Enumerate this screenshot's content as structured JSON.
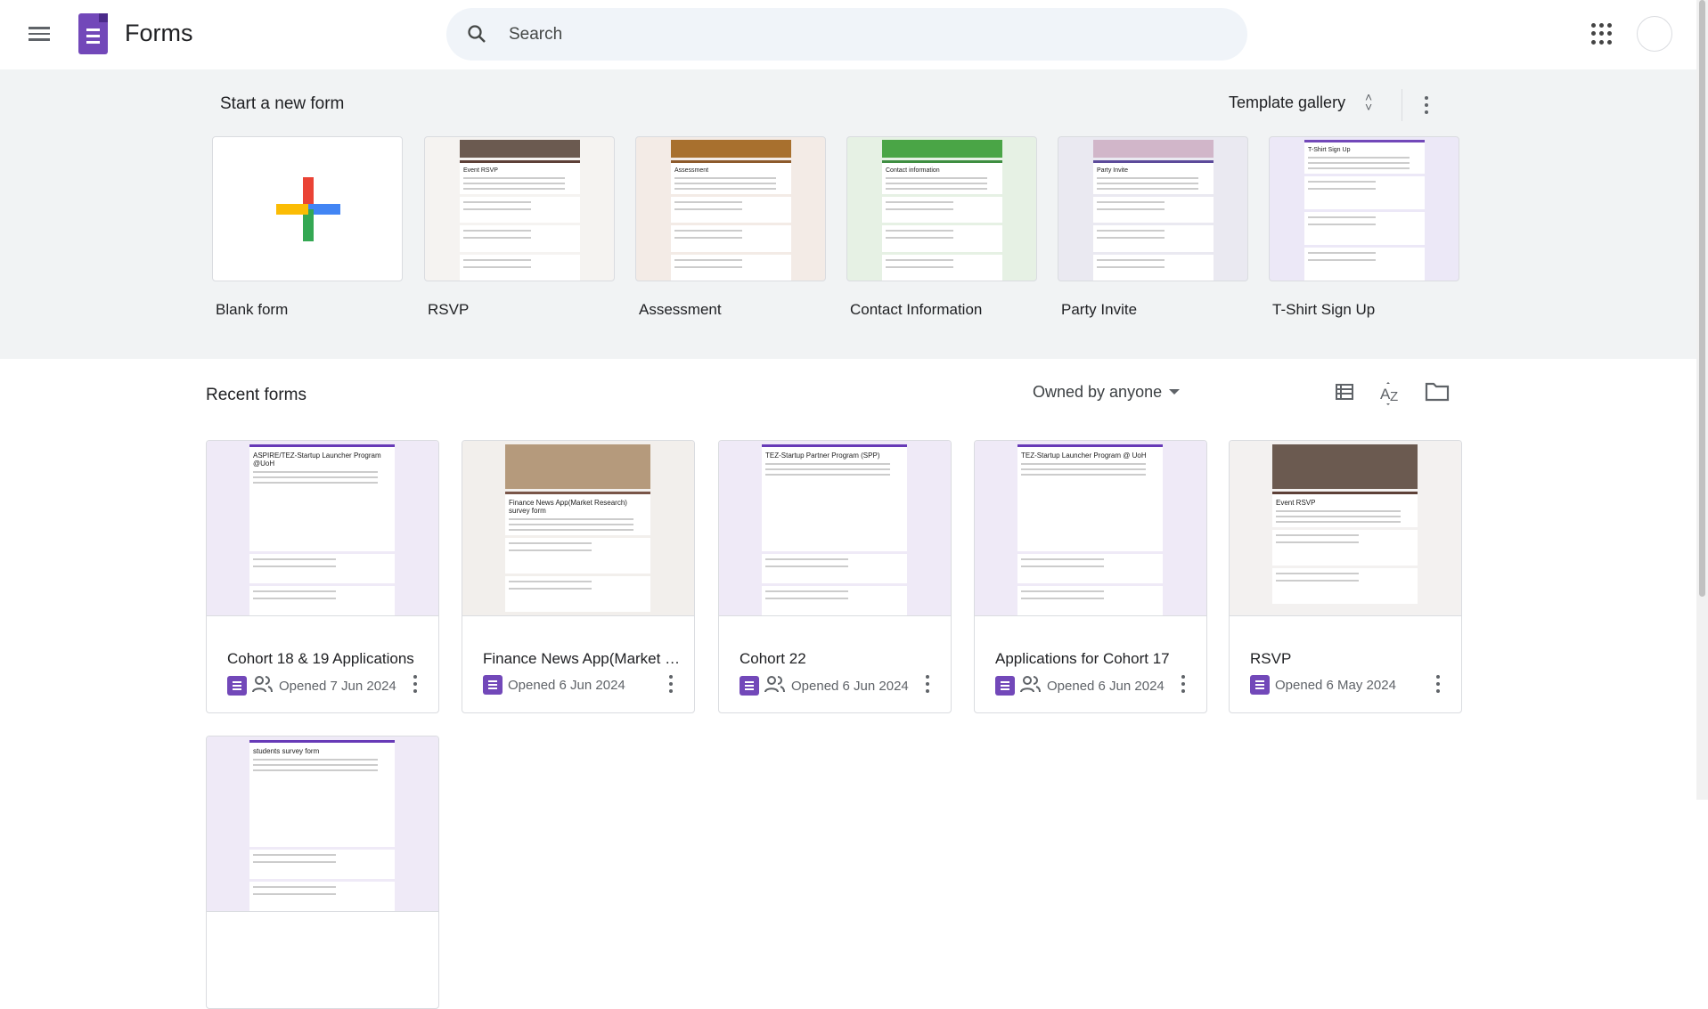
{
  "header": {
    "app_name": "Forms",
    "search_placeholder": "Search"
  },
  "templates": {
    "section_title": "Start a new form",
    "gallery_label": "Template gallery",
    "items": [
      {
        "label": "Blank form",
        "thumb_title": "",
        "bg": "#ffffff",
        "accent": "#ffffff"
      },
      {
        "label": "RSVP",
        "thumb_title": "Event RSVP",
        "bg": "#f5f3f1",
        "accent": "#5d4037",
        "img": "#6b5a50"
      },
      {
        "label": "Assessment",
        "thumb_title": "Assessment",
        "bg": "#f3ebe6",
        "accent": "#8d5a2b",
        "img": "#a8702e"
      },
      {
        "label": "Contact Information",
        "thumb_title": "Contact information",
        "bg": "#e6f1e4",
        "accent": "#3e8e41",
        "img": "#4aa546"
      },
      {
        "label": "Party Invite",
        "thumb_title": "Party Invite",
        "bg": "#eae9f1",
        "accent": "#5c4a9a",
        "img": "#d1b6c9"
      },
      {
        "label": "T-Shirt Sign Up",
        "thumb_title": "T-Shirt Sign Up",
        "bg": "#ece8f7",
        "accent": "#7248b9"
      }
    ]
  },
  "recent": {
    "title": "Recent forms",
    "owner_filter": "Owned by anyone",
    "items": [
      {
        "title": "Cohort 18 & 19 Applications",
        "opened": "Opened 7 Jun 2024",
        "shared": true,
        "thumb_title": "ASPIRE/TEZ-Startup Launcher Program @UoH",
        "accent": "#673ab7",
        "bg": "#efeaf7"
      },
      {
        "title": "Finance News App(Market Research)",
        "opened": "Opened 6 Jun 2024",
        "shared": false,
        "thumb_title": "Finance News App(Market Research) survey form",
        "accent": "#795548",
        "bg": "#f2efec",
        "img": "#b59a7c"
      },
      {
        "title": "Cohort 22",
        "opened": "Opened 6 Jun 2024",
        "shared": true,
        "thumb_title": "TEZ-Startup Partner Program (SPP)",
        "accent": "#673ab7",
        "bg": "#efeaf7"
      },
      {
        "title": "Applications for Cohort 17",
        "opened": "Opened 6 Jun 2024",
        "shared": true,
        "thumb_title": "TEZ-Startup Launcher Program @ UoH",
        "accent": "#673ab7",
        "bg": "#efeaf7"
      },
      {
        "title": "RSVP",
        "opened": "Opened 6 May 2024",
        "shared": false,
        "thumb_title": "Event RSVP",
        "accent": "#5d4037",
        "bg": "#f3f1f0",
        "img": "#6b5a50"
      },
      {
        "title": "",
        "opened": "",
        "shared": false,
        "thumb_title": "students survey form",
        "accent": "#673ab7",
        "bg": "#efeaf7"
      }
    ]
  }
}
